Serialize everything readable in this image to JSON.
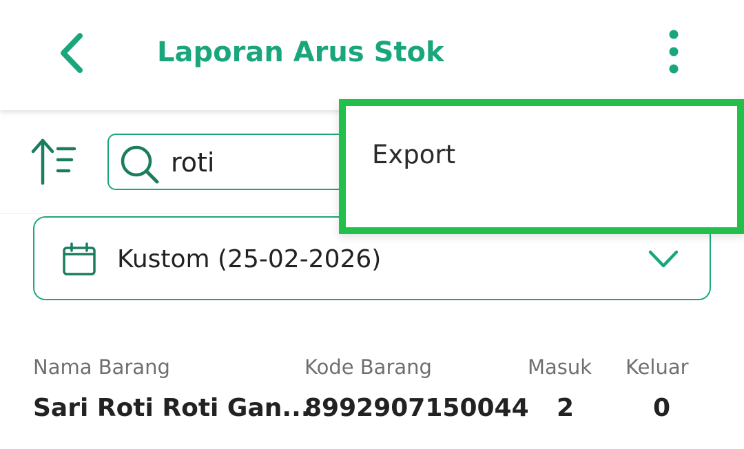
{
  "header": {
    "title": "Laporan Arus Stok",
    "back_icon": "chevron-left-icon",
    "more_icon": "more-vertical-icon"
  },
  "toolbar": {
    "sort_icon": "sort-ascending-icon",
    "search": {
      "value": "roti",
      "icon": "search-icon"
    }
  },
  "date_filter": {
    "label": "Kustom (25-02-2026)",
    "icon": "calendar-icon",
    "dropdown_icon": "chevron-down-icon"
  },
  "table": {
    "columns": [
      "Nama Barang",
      "Kode Barang",
      "Masuk",
      "Keluar"
    ],
    "rows": [
      {
        "nama": "Sari Roti Roti Gan...",
        "kode": "8992907150044",
        "masuk": "2",
        "keluar": "0"
      }
    ]
  },
  "menu": {
    "items": [
      {
        "label": "Export"
      }
    ]
  },
  "colors": {
    "accent": "#1aa67c",
    "highlight_border": "#22c04a",
    "header_text": "#6f6f6f",
    "body_text": "#222222"
  }
}
